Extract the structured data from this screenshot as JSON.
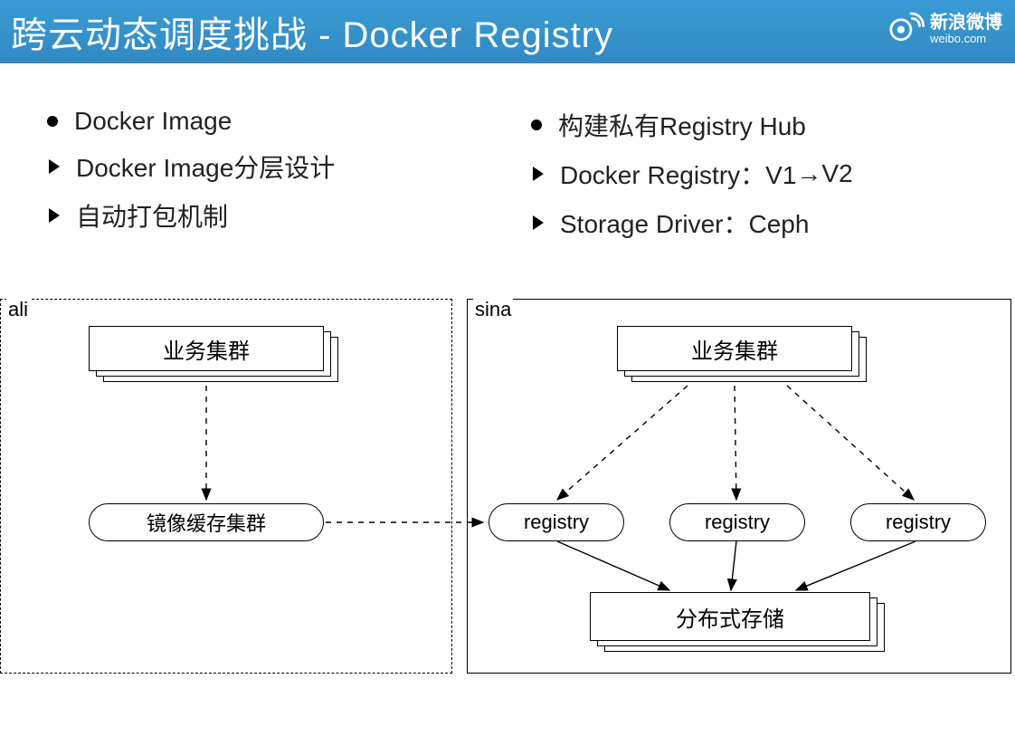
{
  "header": {
    "title": "跨云动态调度挑战 - Docker Registry",
    "logo": {
      "cn": "新浪微博",
      "en": "weibo.com"
    }
  },
  "left": {
    "b1": "Docker Image",
    "c1": "Docker Image分层设计",
    "c2": "自动打包机制"
  },
  "right": {
    "b1": "构建私有Registry Hub",
    "c1_pre": "Docker Registry：V1 ",
    "c1_post": " V2",
    "c2": "Storage Driver：Ceph"
  },
  "diagram": {
    "ali_label": "ali",
    "sina_label": "sina",
    "biz_cluster": "业务集群",
    "cache_cluster": "镜像缓存集群",
    "registry": "registry",
    "dist_storage": "分布式存储"
  }
}
